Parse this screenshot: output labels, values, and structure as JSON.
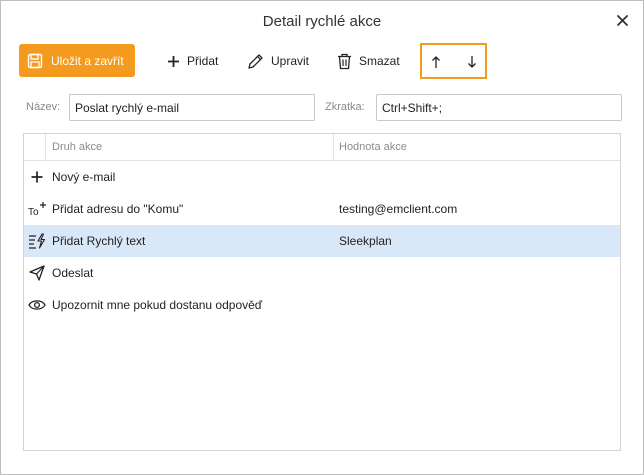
{
  "window": {
    "title": "Detail rychlé akce"
  },
  "toolbar": {
    "save_label": "Uložit a zavřít",
    "add_label": "Přidat",
    "edit_label": "Upravit",
    "delete_label": "Smazat"
  },
  "fields": {
    "name_label": "Název:",
    "name_value": "Poslat rychlý e-mail",
    "shortcut_label": "Zkratka:",
    "shortcut_value": "Ctrl+Shift+;"
  },
  "table": {
    "col_type": "Druh akce",
    "col_value": "Hodnota akce",
    "rows": [
      {
        "icon": "plus-icon",
        "type": "Nový e-mail",
        "value": ""
      },
      {
        "icon": "to-plus-icon",
        "type": "Přidat adresu do \"Komu\"",
        "value": "testing@emclient.com"
      },
      {
        "icon": "quick-text-icon",
        "type": "Přidat Rychlý text",
        "value": "Sleekplan",
        "selected": true
      },
      {
        "icon": "send-icon",
        "type": "Odeslat",
        "value": ""
      },
      {
        "icon": "eye-icon",
        "type": "Upozornit mne pokud dostanu odpověď",
        "value": ""
      }
    ]
  },
  "colors": {
    "accent": "#f39a1f",
    "selected_row": "#d8e8f9"
  }
}
